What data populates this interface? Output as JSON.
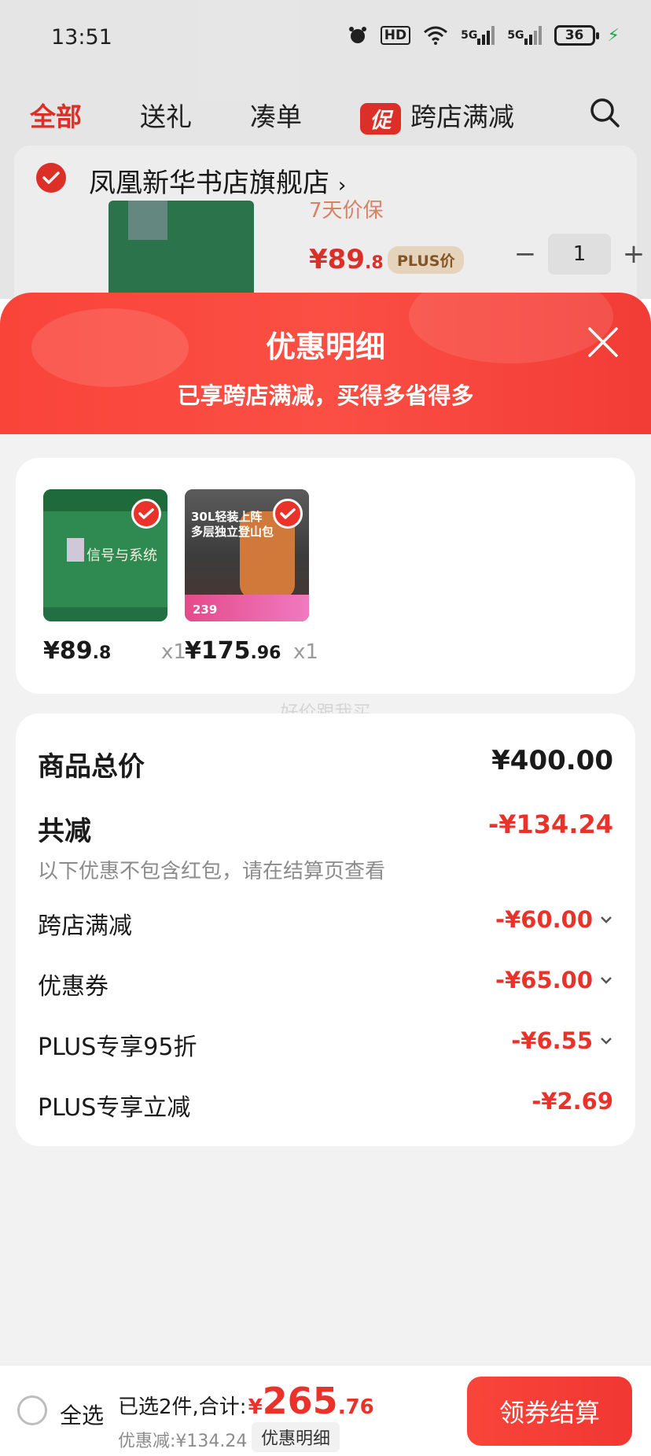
{
  "status_bar": {
    "time": "13:51",
    "hd_label": "HD",
    "net1": "5G",
    "net2": "5G",
    "battery": "36"
  },
  "tabs": [
    {
      "label": "全部",
      "active": true
    },
    {
      "label": "送礼",
      "active": false
    },
    {
      "label": "凑单",
      "active": false
    },
    {
      "label": "跨店满减",
      "badge": "促",
      "active": false
    }
  ],
  "store": {
    "name": "凤凰新华书店旗舰店",
    "partial_text": "7天价保",
    "price_int": "¥89",
    "price_dec": ".8",
    "plus_tag": "PLUS价",
    "quantity": "1",
    "minus": "−",
    "plus": "+"
  },
  "modal": {
    "title": "优惠明细",
    "subtitle": "已享跨店满减，买得多省得多",
    "products": [
      {
        "price_int": "¥89",
        "price_dec": ".8",
        "qty": "x1",
        "cover_title": "信号与系统"
      },
      {
        "price_int": "¥175",
        "price_dec": ".96",
        "qty": "x1",
        "cover_title": "30L轻装上阵\n多层独立登山包",
        "cover_price": "239"
      }
    ],
    "watermark": "好价跟我买",
    "summary": {
      "total_label": "商品总价",
      "total_value": "¥400.00",
      "reduce_label": "共减",
      "reduce_value": "-¥134.24",
      "hint": "以下优惠不包含红包，请在结算页查看",
      "items": [
        {
          "label": "跨店满减",
          "value": "-¥60.00",
          "expandable": true
        },
        {
          "label": "优惠券",
          "value": "-¥65.00",
          "expandable": true
        },
        {
          "label": "PLUS专享95折",
          "value": "-¥6.55",
          "expandable": true
        },
        {
          "label": "PLUS专享立减",
          "value": "-¥2.69",
          "expandable": false
        }
      ]
    }
  },
  "bottom_bar": {
    "select_all": "全选",
    "sum_prefix": "已选2件,合计:",
    "sum_yen": "¥",
    "sum_int": "265",
    "sum_dec": ".76",
    "discount": "优惠减:¥134.24",
    "detail_button": "优惠明细",
    "checkout_button": "领券结算"
  },
  "colors": {
    "accent": "#e8322a",
    "header_gradient_start": "#f9443a",
    "header_gradient_end": "#f23c36"
  }
}
